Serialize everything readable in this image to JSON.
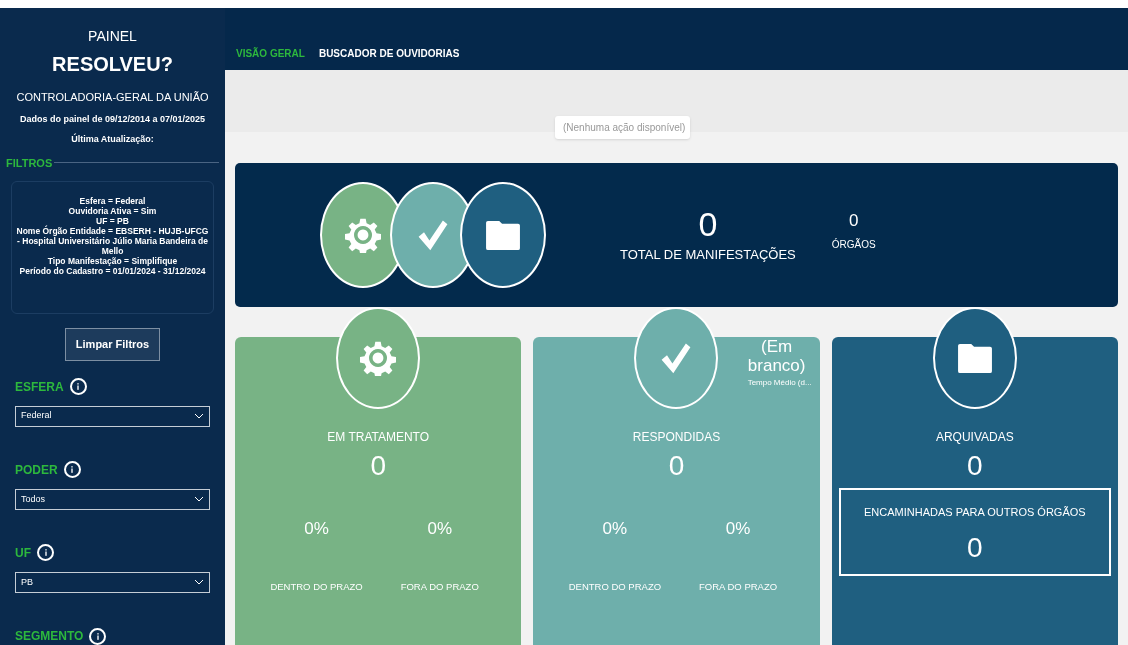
{
  "sidebar": {
    "title_top": "PAINEL",
    "title": "RESOLVEU?",
    "org": "CONTROLADORIA-GERAL DA UNIÃO",
    "period": "Dados do painel de 09/12/2014 a 07/01/2025",
    "updated": "Última Atualização:",
    "filters_heading": "FILTROS",
    "active_filters": [
      "Esfera = Federal",
      "Ouvidoria Ativa = Sim",
      "UF = PB",
      "Nome Órgão Entidade = EBSERH - HUJB-UFCG - Hospital Universitário Júlio Maria Bandeira de Mello",
      "Tipo Manifestação = Simplifique",
      "Período do Cadastro = 01/01/2024 - 31/12/2024"
    ],
    "clear_button": "Limpar Filtros",
    "sections": [
      {
        "label": "ESFERA",
        "value": "Federal"
      },
      {
        "label": "PODER",
        "value": "Todos"
      },
      {
        "label": "UF",
        "value": "PB"
      },
      {
        "label": "SEGMENTO"
      }
    ]
  },
  "tabs": [
    {
      "label": "VISÃO GERAL",
      "selected": true
    },
    {
      "label": "BUSCADOR DE OUVIDORIAS",
      "selected": false
    }
  ],
  "actions_placeholder": "(Nenhuma ação disponível)",
  "summary": {
    "total": "0",
    "total_label": "TOTAL DE MANIFESTAÇÕES",
    "orgs": "0",
    "orgs_label": "ÓRGÃOS"
  },
  "cards": [
    {
      "kind": "treatment",
      "title": "EM TRATAMENTO",
      "value": "0",
      "percent_in": "0%",
      "percent_out": "0%",
      "label_in": "DENTRO DO PRAZO",
      "label_out": "FORA DO PRAZO"
    },
    {
      "kind": "answered",
      "title": "RESPONDIDAS",
      "value": "0",
      "percent_in": "0%",
      "percent_out": "0%",
      "label_in": "DENTRO DO PRAZO",
      "label_out": "FORA DO PRAZO",
      "side_value": "(Em branco)",
      "side_label": "Tempo Médio (d..."
    },
    {
      "kind": "archived",
      "title": "ARQUIVADAS",
      "value": "0",
      "forwarded_label": "ENCAMINHADAS PARA OUTROS ÓRGÃOS",
      "forwarded_value": "0"
    }
  ]
}
